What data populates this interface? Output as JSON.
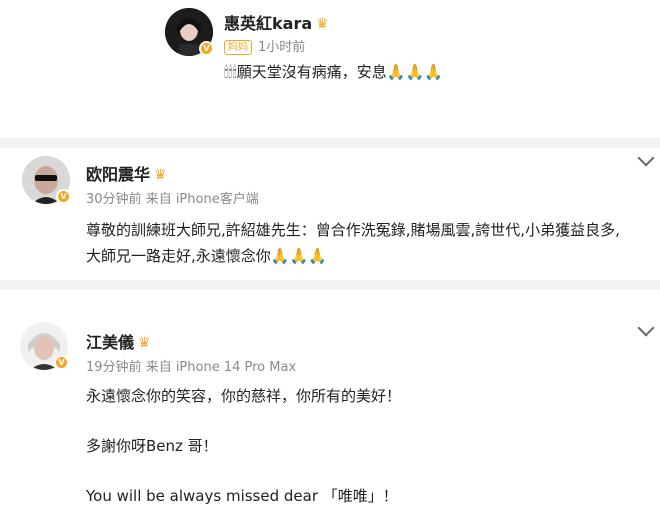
{
  "posts": [
    {
      "name": "惠英紅kara",
      "crown_icon": "crown-icon",
      "badge": "妈妈",
      "time": "1小时前",
      "source": "",
      "lines": [
        "🕯🕯🕯願天堂沒有病痛，安息🙏🙏🙏"
      ]
    },
    {
      "name": "欧阳震华",
      "crown_icon": "crown-icon",
      "time": "30分钟前",
      "source": "来自 iPhone客户端",
      "lines": [
        "尊敬的訓練班大師兄,許紹雄先生：曾合作洗冤錄,賭場風雲,誇世代,小弟獲益良多,",
        "大師兄一路走好,永遠懷念你🙏🙏🙏"
      ]
    },
    {
      "name": "江美儀",
      "crown_icon": "crown-icon",
      "time": "19分钟前",
      "source": "来自 iPhone 14 Pro Max",
      "lines": [
        "永遠懷念你的笑容，你的慈祥，你所有的美好！",
        "多謝你呀Benz 哥！",
        "You will be always missed dear 「唯唯」！"
      ]
    }
  ],
  "colors": {
    "accent": "#f5a623",
    "divider": "#f2f2f2",
    "meta": "#8a8a8a"
  }
}
